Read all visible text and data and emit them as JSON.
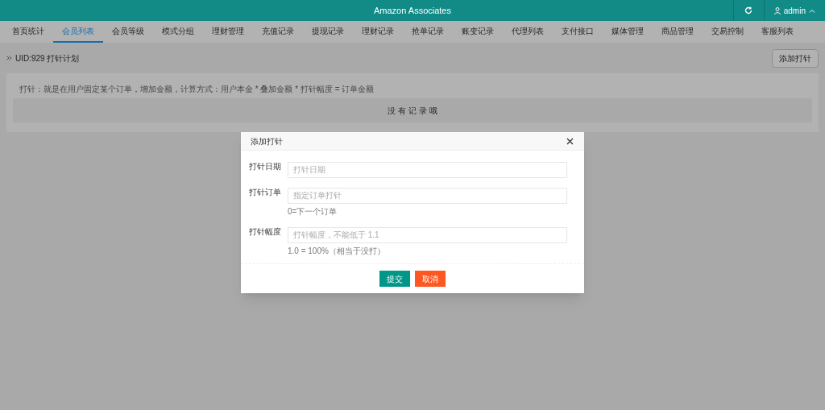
{
  "header": {
    "title": "Amazon Associates",
    "user": "admin"
  },
  "tabs": [
    {
      "label": "首页统计",
      "selected": false
    },
    {
      "label": "会员列表",
      "selected": true
    },
    {
      "label": "会员等级",
      "selected": false
    },
    {
      "label": "模式分组",
      "selected": false
    },
    {
      "label": "理财管理",
      "selected": false
    },
    {
      "label": "充值记录",
      "selected": false
    },
    {
      "label": "提现记录",
      "selected": false
    },
    {
      "label": "理财记录",
      "selected": false
    },
    {
      "label": "抢单记录",
      "selected": false
    },
    {
      "label": "账变记录",
      "selected": false
    },
    {
      "label": "代理列表",
      "selected": false
    },
    {
      "label": "支付接口",
      "selected": false
    },
    {
      "label": "媒体管理",
      "selected": false
    },
    {
      "label": "商品管理",
      "selected": false
    },
    {
      "label": "交易控制",
      "selected": false
    },
    {
      "label": "客服列表",
      "selected": false
    }
  ],
  "breadcrumb": "UID:929 打针计划",
  "add_button": "添加打针",
  "note": "打针：就是在用户固定某个订单，增加金额，计算方式：用户本金 * 叠加金额 * 打针幅度 = 订单金额",
  "empty_text": "没 有 记 录 哦",
  "dialog": {
    "title": "添加打针",
    "fields": [
      {
        "label": "打针日期",
        "placeholder": "打针日期"
      },
      {
        "label": "打针订单",
        "placeholder": "指定订单打针",
        "hint": "0=下一个订单"
      },
      {
        "label": "打针幅度",
        "placeholder": "打针幅度，不能低于 1.1",
        "hint": "1.0 = 100%（相当于没打）"
      }
    ],
    "buttons": [
      {
        "label": "提交",
        "kind": "primary"
      },
      {
        "label": "取消",
        "kind": "danger"
      }
    ]
  }
}
